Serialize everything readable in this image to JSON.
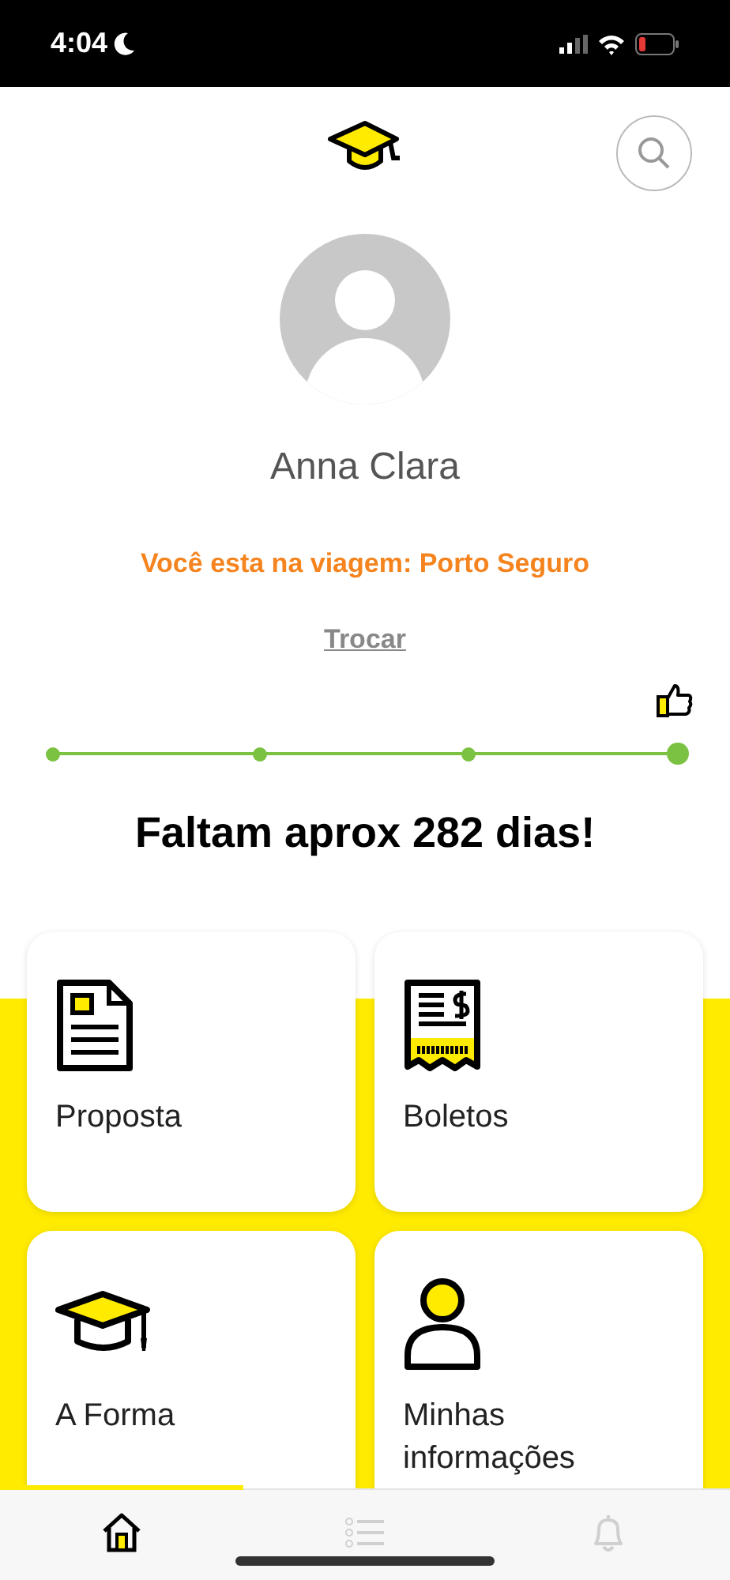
{
  "status_bar": {
    "time": "4:04"
  },
  "profile": {
    "name": "Anna Clara",
    "trip_text": "Você esta na viagem: Porto Seguro",
    "change_link": "Trocar"
  },
  "progress": {
    "steps": [
      {
        "current": false
      },
      {
        "current": false
      },
      {
        "current": false
      },
      {
        "current": true
      }
    ]
  },
  "countdown": "Faltam aprox 282 dias!",
  "cards": [
    {
      "kind": "document",
      "label": "Proposta"
    },
    {
      "kind": "bill",
      "label": "Boletos"
    },
    {
      "kind": "cap",
      "label": "A Forma"
    },
    {
      "kind": "person",
      "label": "Minhas informações"
    }
  ],
  "tab_bar": [
    {
      "kind": "home",
      "selected": true
    },
    {
      "kind": "list",
      "selected": false
    },
    {
      "kind": "bell",
      "selected": false
    }
  ]
}
